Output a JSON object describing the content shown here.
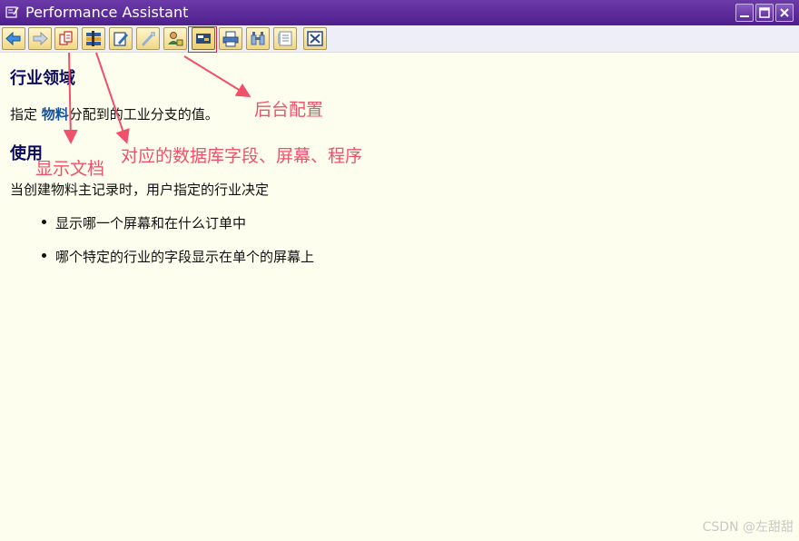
{
  "window": {
    "title": "Performance Assistant"
  },
  "toolbar": {
    "buttons": [
      {
        "icon": "back-arrow-icon"
      },
      {
        "icon": "forward-arrow-icon"
      },
      {
        "icon": "display-document-icon"
      },
      {
        "icon": "technical-info-icon"
      },
      {
        "icon": "edit-icon"
      },
      {
        "icon": "pen-icon"
      },
      {
        "icon": "user-settings-icon"
      },
      {
        "icon": "customizing-icon"
      },
      {
        "icon": "print-icon"
      },
      {
        "icon": "find-icon"
      },
      {
        "icon": "notes-icon"
      },
      {
        "icon": "close-icon"
      }
    ]
  },
  "content": {
    "heading1": "行业领域",
    "para1_before": "指定 ",
    "para1_link": "物料",
    "para1_after": "分配到的工业分支的值。",
    "heading2": "使用",
    "para2": "当创建物料主记录时，用户指定的行业决定",
    "bullets": [
      "显示哪一个屏幕和在什么订单中",
      "哪个特定的行业的字段显示在单个的屏幕上"
    ]
  },
  "annotations": {
    "backend_config": "后台配置",
    "db_field": "对应的数据库字段、屏幕、程序",
    "display_doc": "显示文档"
  },
  "watermark": "CSDN @左甜甜",
  "colors": {
    "titlebar": "#5a2a98",
    "background": "#fefeee",
    "heading": "#0a0a60",
    "annotation": "#f0506a"
  }
}
